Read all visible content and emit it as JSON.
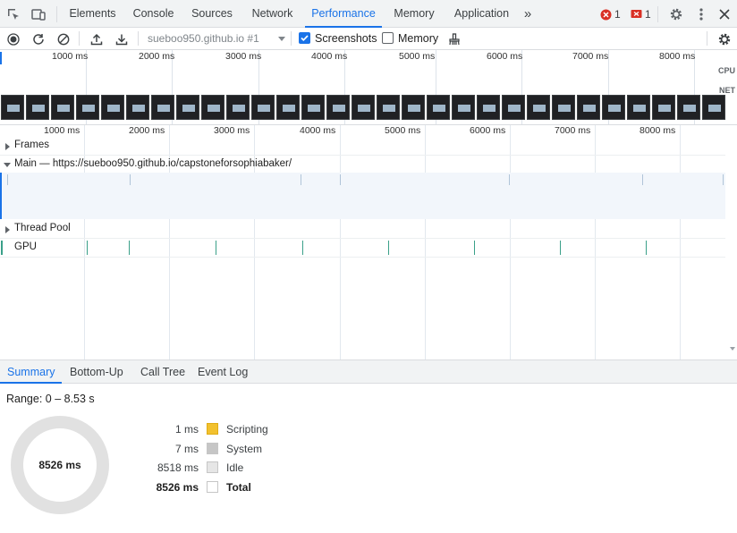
{
  "tabs": [
    "Elements",
    "Console",
    "Sources",
    "Network",
    "Performance",
    "Memory",
    "Application"
  ],
  "active_tab": "Performance",
  "more_tabs_glyph": "»",
  "errors": {
    "error_count": "1",
    "issue_count": "1"
  },
  "toolbar": {
    "target": "sueboo950.github.io #1",
    "screenshots_label": "Screenshots",
    "screenshots_checked": true,
    "memory_label": "Memory",
    "memory_checked": false
  },
  "overview": {
    "ticks": [
      "1000 ms",
      "2000 ms",
      "3000 ms",
      "4000 ms",
      "5000 ms",
      "6000 ms",
      "7000 ms",
      "8000 ms"
    ],
    "cpu_label": "CPU",
    "net_label": "NET"
  },
  "timeline": {
    "ticks": [
      "1000 ms",
      "2000 ms",
      "3000 ms",
      "4000 ms",
      "5000 ms",
      "6000 ms",
      "7000 ms",
      "8000 ms"
    ],
    "tracks": {
      "frames": "Frames",
      "main": "Main — https://sueboo950.github.io/capstoneforsophiabaker/",
      "thread_pool": "Thread Pool",
      "gpu": "GPU"
    }
  },
  "bottom_tabs": [
    "Summary",
    "Bottom-Up",
    "Call Tree",
    "Event Log"
  ],
  "summary": {
    "range": "Range: 0 – 8.53 s",
    "donut_total": "8526 ms",
    "rows": [
      {
        "value": "1 ms",
        "name": "Scripting",
        "color": "#f2c12e"
      },
      {
        "value": "7 ms",
        "name": "System",
        "color": "#c6c6c6"
      },
      {
        "value": "8518 ms",
        "name": "Idle",
        "color": "#e6e6e6"
      },
      {
        "value": "8526 ms",
        "name": "Total",
        "color": "#ffffff"
      }
    ]
  },
  "colors": {
    "accent": "#1a73e8",
    "error": "#d93025",
    "gpu": "#3aa089"
  }
}
